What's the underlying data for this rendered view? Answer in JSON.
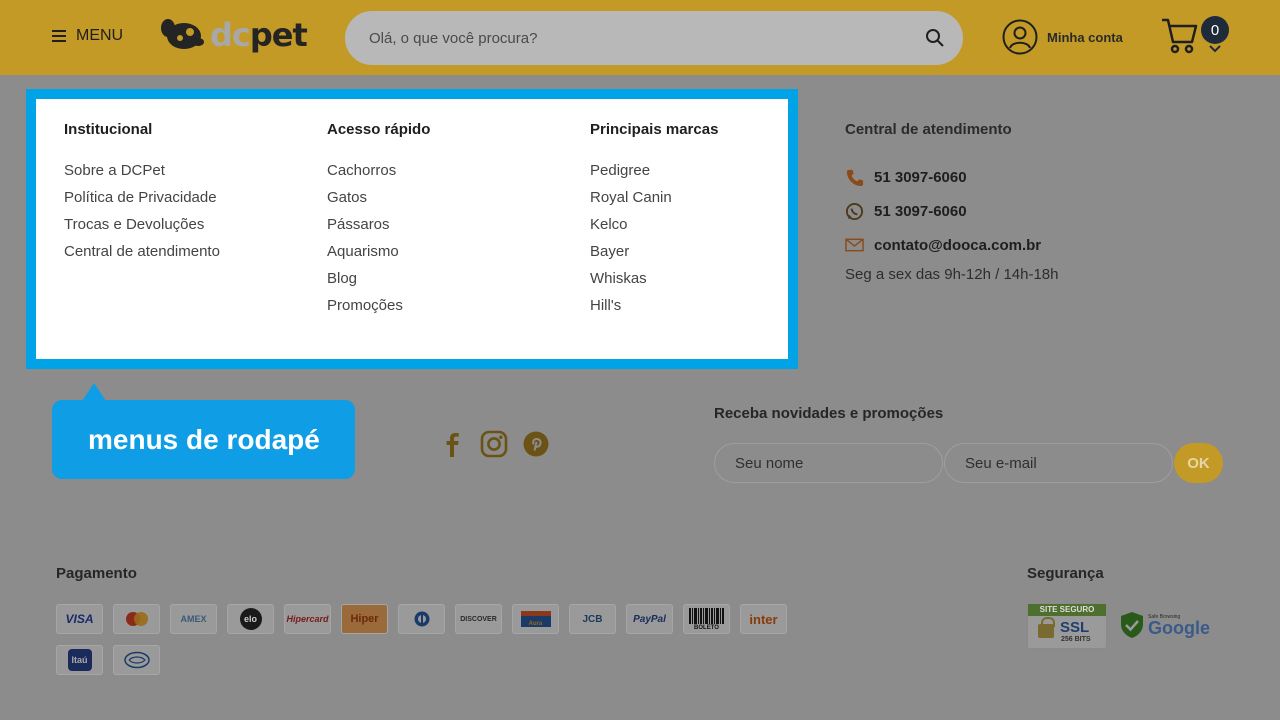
{
  "header": {
    "menu_label": "MENU",
    "logo_dc": "dc",
    "logo_pet": "pet",
    "search_placeholder": "Olá, o que você procura?",
    "account_label": "Minha conta",
    "cart_count": "0"
  },
  "footer_menus": [
    {
      "title": "Institucional",
      "items": [
        "Sobre a DCPet",
        "Política de Privacidade",
        "Trocas e Devoluções",
        "Central de atendimento"
      ]
    },
    {
      "title": "Acesso rápido",
      "items": [
        "Cachorros",
        "Gatos",
        "Pássaros",
        "Aquarismo",
        "Blog",
        "Promoções"
      ]
    },
    {
      "title": "Principais marcas",
      "items": [
        "Pedigree",
        "Royal Canin",
        "Kelco",
        "Bayer",
        "Whiskas",
        "Hill's"
      ]
    }
  ],
  "contact": {
    "title": "Central de atendimento",
    "phone": "51 3097-6060",
    "whatsapp": "51 3097-6060",
    "email": "contato@dooca.com.br",
    "hours": "Seg a sex das 9h-12h / 14h-18h"
  },
  "callout": {
    "text": "menus de rodapé"
  },
  "social": [
    "facebook",
    "instagram",
    "pinterest"
  ],
  "newsletter": {
    "title": "Receba novidades e promoções",
    "name_placeholder": "Seu nome",
    "email_placeholder": "Seu e-mail",
    "submit_label": "OK"
  },
  "payment": {
    "title": "Pagamento",
    "methods": [
      {
        "name": "visa",
        "label": "VISA"
      },
      {
        "name": "mastercard",
        "label": ""
      },
      {
        "name": "amex",
        "label": "AMEX"
      },
      {
        "name": "elo",
        "label": "elo"
      },
      {
        "name": "hipercard",
        "label": "Hipercard"
      },
      {
        "name": "hiper",
        "label": "Hiper"
      },
      {
        "name": "diners",
        "label": ""
      },
      {
        "name": "discover",
        "label": "DISCOVER"
      },
      {
        "name": "aura",
        "label": "Aura"
      },
      {
        "name": "jcb",
        "label": "JCB"
      },
      {
        "name": "paypal",
        "label": "PayPal"
      },
      {
        "name": "boleto",
        "label": "BOLETO"
      },
      {
        "name": "inter",
        "label": "inter"
      },
      {
        "name": "itau",
        "label": "Itaú"
      },
      {
        "name": "mercadopago",
        "label": ""
      }
    ]
  },
  "security": {
    "title": "Segurança",
    "ssl_top": "SITE SEGURO",
    "ssl_main": "SSL",
    "ssl_sub": "256 BITS",
    "google_small": "Safe Browsing",
    "google_text": "Google"
  },
  "colors": {
    "header_bg": "#c39a25",
    "overlay_bg": "#8c8c8c",
    "highlight": "#00a3e6",
    "callout": "#0f9de5",
    "accent": "#c39a25"
  }
}
